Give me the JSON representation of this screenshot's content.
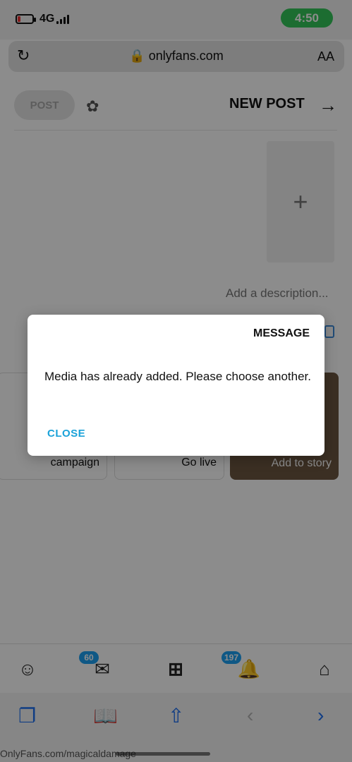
{
  "status_bar": {
    "time": "4:50",
    "network": "4G"
  },
  "address_bar": {
    "url": "onlyfans.com",
    "text_size_label": "AA"
  },
  "header": {
    "title": "NEW POST",
    "post_button": "POST"
  },
  "upload": {
    "plus": "+"
  },
  "description_placeholder": "Add a description...",
  "cards": [
    {
      "label": "Add to story"
    },
    {
      "label": "Go live"
    },
    {
      "label": "campaign"
    }
  ],
  "tabbar": {
    "notifications_badge": "197",
    "messages_badge": "60"
  },
  "dialog": {
    "title": "MESSAGE",
    "message": "Media has already added. Please choose another.",
    "close_label": "CLOSE"
  },
  "footer": {
    "page_url": "OnlyFans.com/magicaldamage"
  }
}
